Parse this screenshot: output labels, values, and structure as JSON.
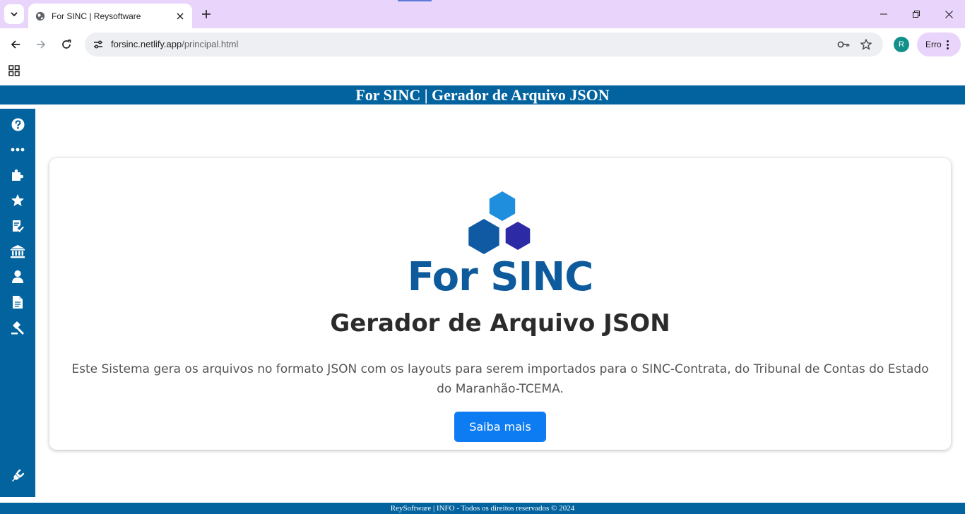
{
  "browser": {
    "tab_title": "For SINC | Reysoftware",
    "url_host": "forsinc.netlify.app",
    "url_path": "/principal.html",
    "profile_initial": "R",
    "profile_status": "Erro"
  },
  "page": {
    "header_title": "For SINC | Gerador de Arquivo JSON",
    "logo_text": "For SINC",
    "card_title": "Gerador de Arquivo JSON",
    "card_description": "Este Sistema gera os arquivos no formato JSON com os layouts para serem importados para o SINC-Contrata, do Tribunal de Contas do Estado do Maranhão-TCEMA.",
    "cta_label": "Saiba mais",
    "footer_text": "ReySoftware | INFO - Todos os direitos reservados © 2024"
  },
  "sidebar": {
    "icons": [
      "question-icon",
      "more-icon",
      "puzzle-icon",
      "star-icon",
      "checklist-icon",
      "bank-icon",
      "user-icon",
      "document-icon",
      "gavel-icon",
      "plug-icon"
    ]
  },
  "colors": {
    "brand_blue": "#03639f",
    "button_blue": "#0d7cf2",
    "logo_blue": "#0d5a9c",
    "tabstrip_purple": "#e9d5fb"
  }
}
